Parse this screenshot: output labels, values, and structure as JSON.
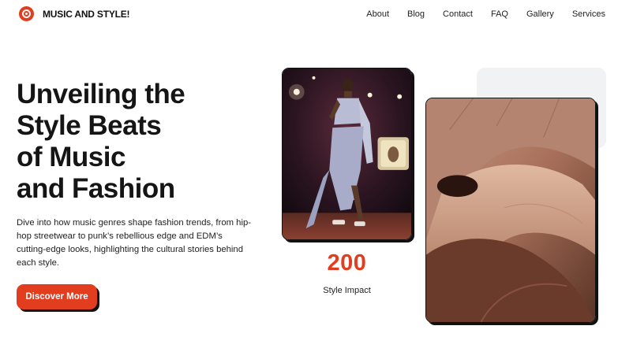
{
  "header": {
    "brand": "MUSIC AND STYLE!",
    "logo_icon": "vinyl-record-icon",
    "nav": [
      "About",
      "Blog",
      "Contact",
      "FAQ",
      "Gallery",
      "Services"
    ]
  },
  "hero": {
    "title_lines": [
      "Unveiling the",
      "Style Beats",
      "of Music",
      "and Fashion"
    ],
    "description": "Dive into how music genres shape fashion trends, from hip-hop streetwear to punk’s rebellious edge and EDM’s cutting-edge looks, highlighting the cultural stories behind each style.",
    "cta_label": "Discover More"
  },
  "stat": {
    "number": "200",
    "label": "Style Impact"
  },
  "colors": {
    "accent": "#e23d1e",
    "text": "#151515",
    "panel": "#f1f2f4"
  }
}
